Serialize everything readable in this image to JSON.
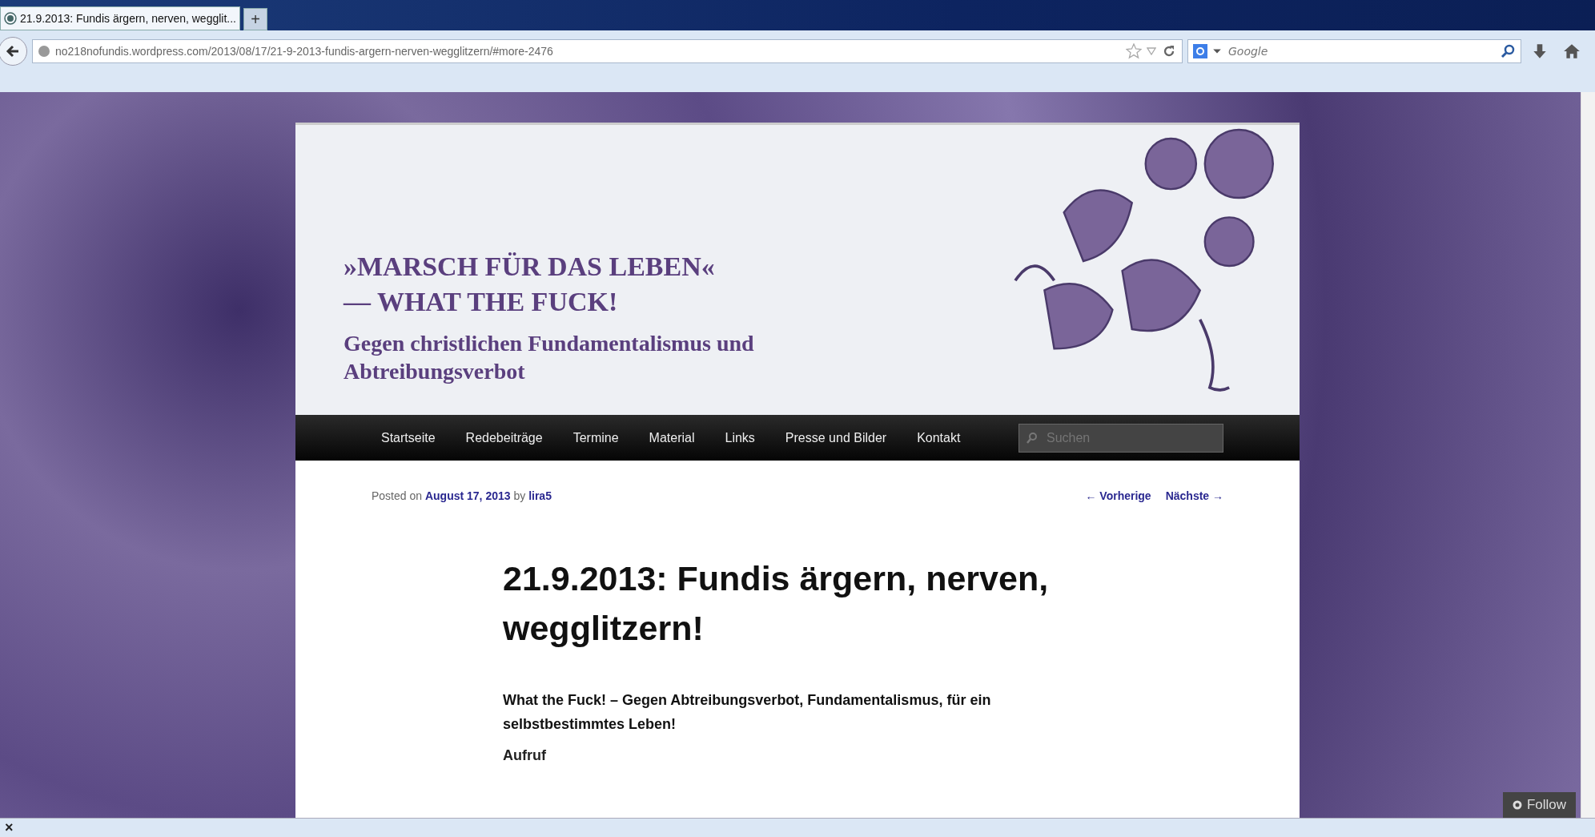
{
  "browser": {
    "tab": {
      "title": "21.9.2013: Fundis ärgern, nerven, wegglit...",
      "selected": true
    },
    "new_tab": "+",
    "url": "no218nofundis.wordpress.com/2013/08/17/21-9-2013-fundis-argern-nerven-wegglitzern/#more-2476",
    "search": {
      "placeholder": "Google"
    }
  },
  "site": {
    "title": "»MARSCH FÜR DAS LEBEN« — WHAT THE FUCK!",
    "tagline": "Gegen christlichen Fundamentalismus und Abtreibungsverbot"
  },
  "nav": {
    "items": [
      {
        "label": "Startseite"
      },
      {
        "label": "Redebeiträge"
      },
      {
        "label": "Termine"
      },
      {
        "label": "Material"
      },
      {
        "label": "Links"
      },
      {
        "label": "Presse und Bilder"
      },
      {
        "label": "Kontakt"
      }
    ],
    "search": {
      "placeholder": "Suchen"
    }
  },
  "post": {
    "meta": {
      "posted_on": "Posted on",
      "date": "August 17, 2013",
      "by": "by",
      "author": "lira5"
    },
    "prev": "← Vorherige",
    "next": "Nächste →",
    "title": "21.9.2013: Fundis ärgern, nerven, wegglitzern!",
    "lead": "What the Fuck! – Gegen Abtreibungsverbot, Fundamentalismus, für ein selbstbestimmtes Leben!",
    "subheading": "Aufruf"
  },
  "follow": "Follow",
  "status_bar": {
    "close": "×"
  }
}
